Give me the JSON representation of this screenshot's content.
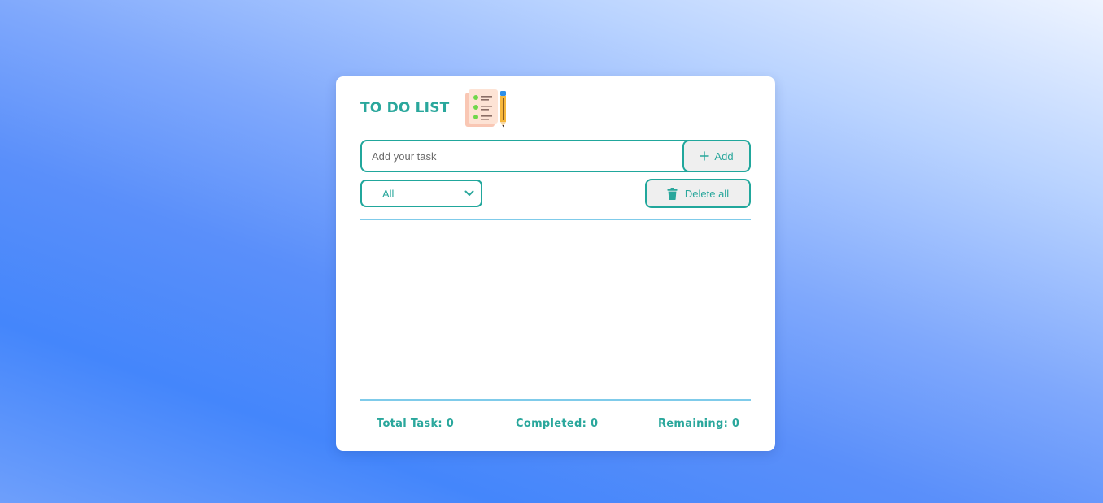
{
  "app": {
    "title": "TO DO LIST",
    "logo_icon": "checklist-pencil-icon"
  },
  "input": {
    "placeholder": "Add your task",
    "value": ""
  },
  "add_button": {
    "label": "Add",
    "icon": "plus-icon"
  },
  "filter": {
    "selected": "All",
    "icon": "chevron-down-icon"
  },
  "delete_all_button": {
    "label": "Delete all",
    "icon": "trash-icon"
  },
  "tasks": [],
  "stats": {
    "total_label": "Total Task:",
    "total_value": "0",
    "completed_label": "Completed:",
    "completed_value": "0",
    "remaining_label": "Remaining:",
    "remaining_value": "0"
  },
  "colors": {
    "accent": "#21a79c",
    "divider": "#7fcbea",
    "button_bg": "#efefef",
    "card_bg": "#ffffff"
  }
}
